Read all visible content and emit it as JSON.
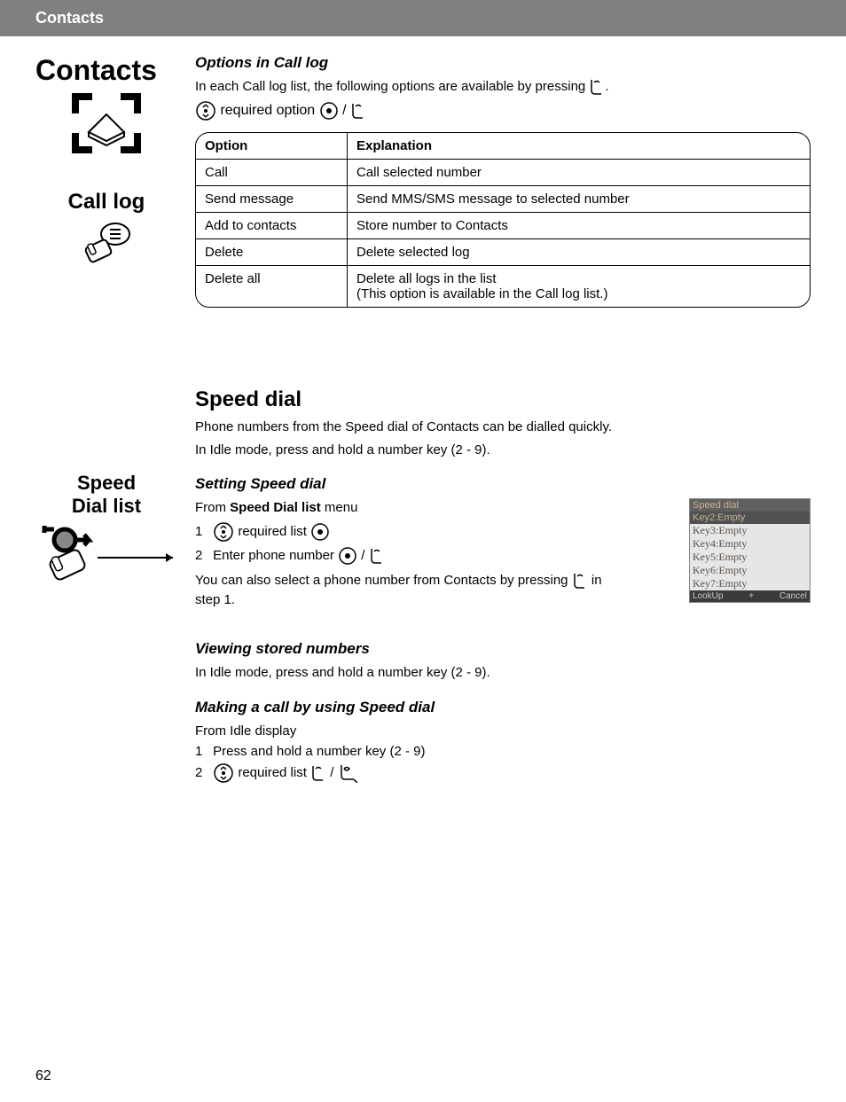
{
  "header": {
    "title": "Contacts"
  },
  "sidebar": {
    "main_title": "Contacts",
    "calllog_title": "Call log",
    "speeddial_title_l1": "Speed",
    "speeddial_title_l2": "Dial list"
  },
  "sections": {
    "options_title": "Options in Call log",
    "options_intro_1": "In each Call log list, the following options are available by pressing ",
    "options_intro_2": ".",
    "options_line2_a": " required option ",
    "options_line2_b": " / ",
    "table": {
      "header_option": "Option",
      "header_expl": "Explanation",
      "rows": [
        {
          "option": "Call",
          "expl": "Call selected number"
        },
        {
          "option": "Send message",
          "expl": "Send MMS/SMS message to selected number"
        },
        {
          "option": "Add to contacts",
          "expl": "Store number to Contacts"
        },
        {
          "option": "Delete",
          "expl": "Delete selected log"
        },
        {
          "option": "Delete all",
          "expl": "Delete all logs in the list\n(This option is available in the Call log list.)"
        }
      ]
    },
    "speeddial_title": "Speed dial",
    "speeddial_p1": "Phone numbers from the Speed dial of Contacts can be dialled quickly.",
    "speeddial_p2": "In Idle mode, press and hold a number key (2 - 9).",
    "setting_title": "Setting Speed dial",
    "setting_from_a": "From ",
    "setting_from_bold": "Speed Dial list",
    "setting_from_b": " menu",
    "setting_s1_num": "1",
    "setting_s1_a": " required list ",
    "setting_s2_num": "2",
    "setting_s2_a": "Enter phone number ",
    "setting_s2_b": " / ",
    "setting_note_a": "You can also select a phone number from Contacts by pressing",
    "setting_note_b": " in step 1.",
    "viewing_title": "Viewing stored numbers",
    "viewing_p": "In Idle mode, press and hold a number key (2 - 9).",
    "making_title": "Making a call by using Speed dial",
    "making_from": "From Idle display",
    "making_s1_num": "1",
    "making_s1": "Press and hold a number key (2 - 9)",
    "making_s2_num": "2",
    "making_s2_a": " required list ",
    "making_s2_b": " / "
  },
  "screen": {
    "title": "Speed dial",
    "hl": "Key2:Empty",
    "rows": [
      "Key3:Empty",
      "Key4:Empty",
      "Key5:Empty",
      "Key6:Empty",
      "Key7:Empty"
    ],
    "foot_left": "LookUp",
    "foot_right": "Cancel"
  },
  "page_number": "62"
}
